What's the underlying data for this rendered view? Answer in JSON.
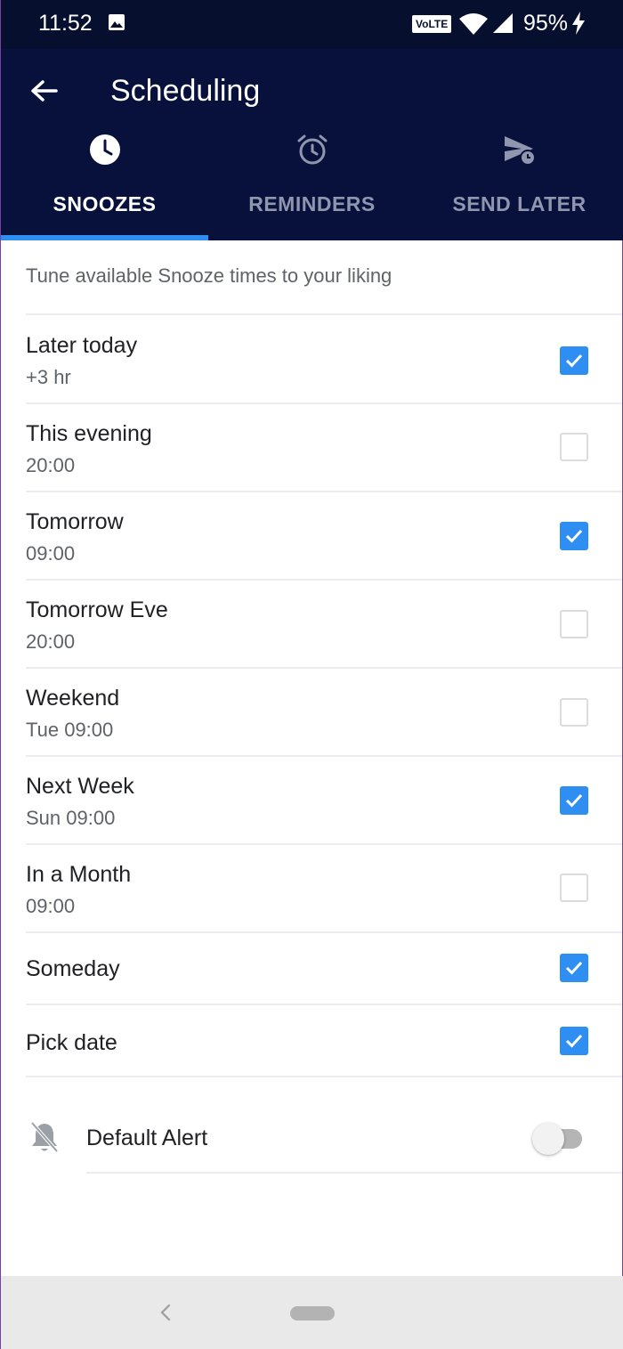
{
  "status_bar": {
    "time": "11:52",
    "volte": "VoLTE",
    "battery": "95%",
    "icons": [
      "image-icon",
      "wifi-icon",
      "signal-icon",
      "charging-icon"
    ]
  },
  "app_bar": {
    "title": "Scheduling",
    "back_icon": "arrow-left-icon"
  },
  "tabs": [
    {
      "label": "SNOOZES",
      "icon": "clock-icon",
      "active": true
    },
    {
      "label": "REMINDERS",
      "icon": "alarm-icon",
      "active": false
    },
    {
      "label": "SEND LATER",
      "icon": "send-later-icon",
      "active": false
    }
  ],
  "content": {
    "subtitle": "Tune available Snooze times to your liking",
    "items": [
      {
        "title": "Later today",
        "subtitle": "+3 hr",
        "checked": true
      },
      {
        "title": "This evening",
        "subtitle": "20:00",
        "checked": false
      },
      {
        "title": "Tomorrow",
        "subtitle": "09:00",
        "checked": true
      },
      {
        "title": "Tomorrow Eve",
        "subtitle": "20:00",
        "checked": false
      },
      {
        "title": "Weekend",
        "subtitle": "Tue 09:00",
        "checked": false
      },
      {
        "title": "Next Week",
        "subtitle": "Sun 09:00",
        "checked": true
      },
      {
        "title": "In a Month",
        "subtitle": "09:00",
        "checked": false
      },
      {
        "title": "Someday",
        "subtitle": "",
        "checked": true
      },
      {
        "title": "Pick date",
        "subtitle": "",
        "checked": true
      }
    ],
    "default_alert": {
      "label": "Default Alert",
      "icon": "bell-off-icon",
      "enabled": false
    }
  },
  "colors": {
    "app_bar": "#07113b",
    "accent": "#2f8ef2",
    "inactive_tab": "#8f96ae"
  }
}
